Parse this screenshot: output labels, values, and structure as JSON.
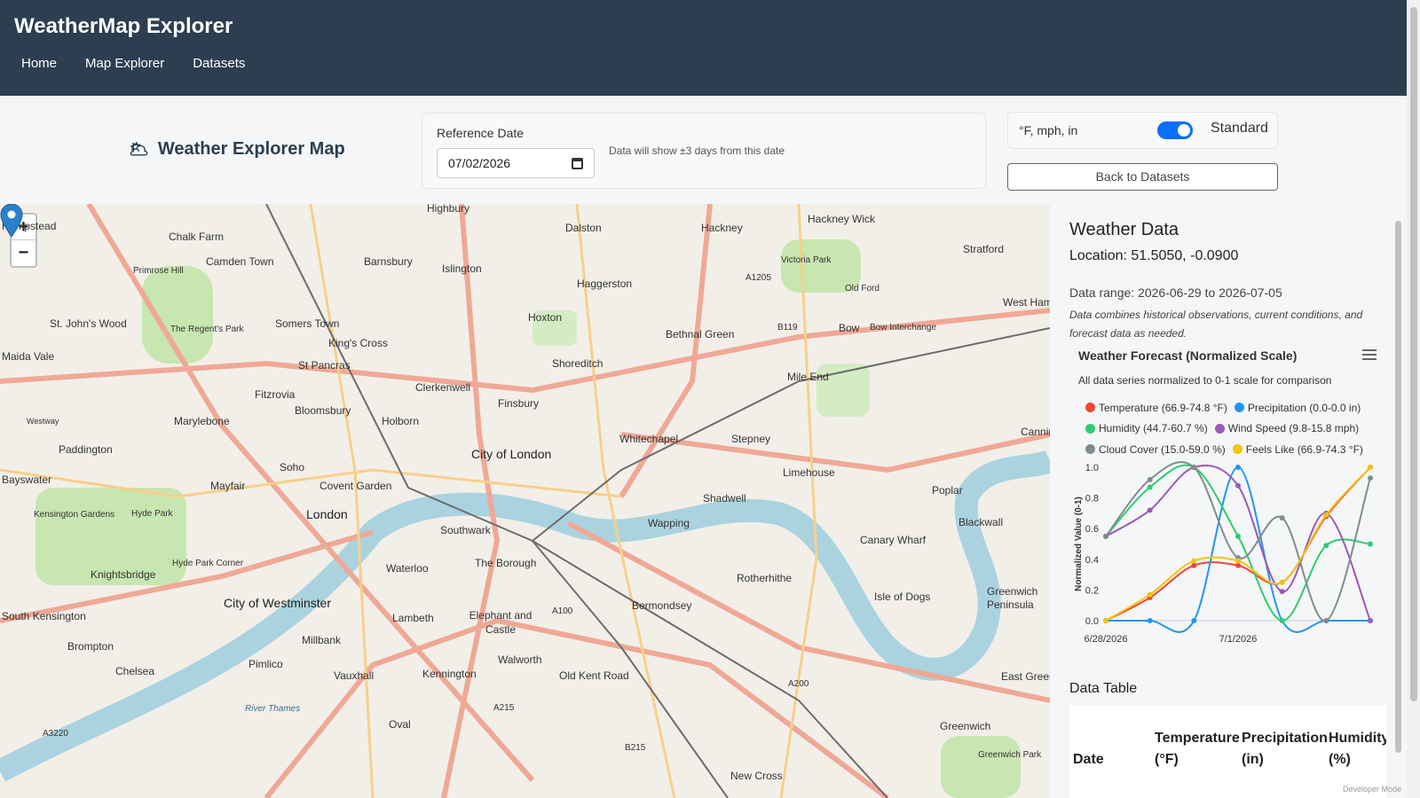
{
  "header": {
    "app_title": "WeatherMap Explorer",
    "nav": [
      "Home",
      "Map Explorer",
      "Datasets"
    ],
    "background": "#2c3e50"
  },
  "page": {
    "title": "Weather Explorer Map",
    "title_icon": "sun-cloud-icon"
  },
  "reference_date": {
    "label": "Reference Date",
    "value": "07/02/2026",
    "hint": "Data will show ±3 days from this date"
  },
  "units": {
    "text": "°F, mph, in",
    "toggle_on": true,
    "toggle_label": "Standard",
    "accent": "#0d6efd"
  },
  "back_button": "Back to Datasets",
  "map": {
    "zoom_in": "+",
    "zoom_out": "−",
    "places": [
      "Highbury",
      "Dalston",
      "Hackney",
      "Hackney Wick",
      "Stratford",
      "Chalk Farm",
      "Hampstead",
      "Camden Town",
      "Barnsbury",
      "Islington",
      "Haggerston",
      "Primrose Hill",
      "A1205",
      "Victoria Park",
      "Old Ford",
      "West Ham",
      "Somers Town",
      "St. John's Wood",
      "The Regent's Park",
      "King's Cross",
      "Hoxton",
      "Bethnal Green",
      "B119",
      "Bow",
      "Bow Interchange",
      "Maida Vale",
      "St Pancras",
      "Shoreditch",
      "Clerkenwell",
      "Fitzrovia",
      "Bloomsbury",
      "Finsbury",
      "Mile End",
      "Marylebone",
      "Holborn",
      "Whitechapel",
      "Stepney",
      "Canning Town",
      "Westway",
      "Paddington",
      "City of London",
      "Soho",
      "Mayfair",
      "Covent Garden",
      "Limehouse",
      "Poplar",
      "Bayswater",
      "Kensington Gardens",
      "Hyde Park",
      "London",
      "Shadwell",
      "Wapping",
      "Southwark",
      "Canary Wharf",
      "Blackwall",
      "Hyde Park Corner",
      "Knightsbridge",
      "Waterloo",
      "The Borough",
      "Rotherhithe",
      "Isle of Dogs",
      "Greenwich Peninsula",
      "City of Westminster",
      "A100",
      "Bermondsey",
      "South Kensington",
      "Lambeth",
      "Elephant and Castle",
      "Millbank",
      "Brompton",
      "Chelsea",
      "Pimlico",
      "Vauxhall",
      "Kennington",
      "Walworth",
      "Old Kent Road",
      "East Greenwich",
      "A200",
      "A215",
      "A3220",
      "Oval",
      "River Thames",
      "B215",
      "Greenwich",
      "New Cross",
      "Greenwich Park"
    ]
  },
  "weather": {
    "title": "Weather Data",
    "location": "Location: 51.5050, -0.0900",
    "range": "Data range: 2026-06-29 to 2026-07-05",
    "note": "Data combines historical observations, current conditions, and forecast data as needed."
  },
  "chart_data": {
    "type": "line",
    "title": "Weather Forecast (Normalized Scale)",
    "subtitle": "All data series normalized to 0-1 scale for comparison",
    "ylabel": "Normalized Value (0-1)",
    "ylim": [
      0,
      1
    ],
    "y_ticks": [
      "0.0",
      "0.2",
      "0.4",
      "0.6",
      "0.8",
      "1.0"
    ],
    "x_ticks": [
      "6/28/2026",
      "7/1/2026"
    ],
    "x": [
      "6/28/2026",
      "6/29/2026",
      "6/30/2026",
      "7/1/2026",
      "7/2/2026",
      "7/3/2026",
      "7/4/2026"
    ],
    "legend_position": "top",
    "grid": false,
    "series": [
      {
        "name": "Temperature (66.9-74.8 °F)",
        "color": "#f44336",
        "values": [
          0.0,
          0.15,
          0.36,
          0.36,
          0.25,
          0.68,
          1.0
        ]
      },
      {
        "name": "Precipitation (0.0-0.0 in)",
        "color": "#2196f3",
        "values": [
          0.0,
          0.0,
          0.0,
          1.0,
          0.0,
          0.0,
          0.0
        ]
      },
      {
        "name": "Humidity (44.7-60.7 %)",
        "color": "#2ecc71",
        "values": [
          0.55,
          0.87,
          1.0,
          0.55,
          0.0,
          0.49,
          0.5
        ]
      },
      {
        "name": "Wind Speed (9.8-15.8 mph)",
        "color": "#9b59b6",
        "values": [
          0.55,
          0.72,
          1.0,
          0.88,
          0.19,
          0.7,
          0.0
        ]
      },
      {
        "name": "Cloud Cover (15.0-59.0 %)",
        "color": "#7f8c8d",
        "values": [
          0.55,
          0.92,
          1.0,
          0.41,
          0.67,
          0.0,
          0.93
        ]
      },
      {
        "name": "Feels Like (66.9-74.3 °F)",
        "color": "#f1c40f",
        "values": [
          0.0,
          0.17,
          0.39,
          0.39,
          0.25,
          0.69,
          1.0
        ]
      }
    ]
  },
  "data_table": {
    "title": "Data Table",
    "columns": [
      "Date",
      "Temperature (°F)",
      "Precipitation (in)",
      "Humidity (%)"
    ]
  },
  "footer": {
    "dev_mode": "Developer Mode"
  }
}
